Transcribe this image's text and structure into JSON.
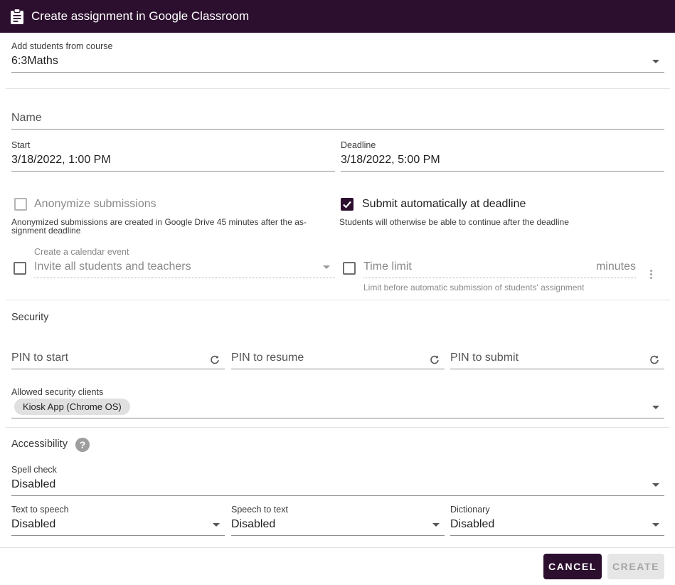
{
  "dialog": {
    "title": "Create assignment in Google Classroom",
    "icon": "clipboard-icon",
    "accent_color": "#2c0f2f"
  },
  "course": {
    "label": "Add students from course",
    "value": "6:3Maths"
  },
  "name": {
    "placeholder": "Name"
  },
  "start": {
    "label": "Start",
    "value": "3/18/2022, 1:00 PM"
  },
  "deadline": {
    "label": "Deadline",
    "value": "3/18/2022, 5:00 PM"
  },
  "anonymize": {
    "label": "Anonymize submissions",
    "help_line1": "Anonymized submissions are created in Google Drive 45 minutes after the as-",
    "help_line2": "signment deadline",
    "checked": false
  },
  "auto_submit": {
    "label": "Submit automatically at deadline",
    "help": "Students will otherwise be able to continue after the deadline",
    "checked": true
  },
  "calendar": {
    "label": "Create a calendar event",
    "value": "Invite all students and teachers",
    "checked": false
  },
  "time_limit": {
    "placeholder": "Time limit",
    "suffix": "minutes",
    "help": "Limit before automatic submission of students' assignment",
    "checked": false
  },
  "security": {
    "heading": "Security",
    "pin_start": "PIN to start",
    "pin_resume": "PIN to resume",
    "pin_submit": "PIN to submit",
    "clients_label": "Allowed security clients",
    "clients": [
      "Kiosk App (Chrome OS)"
    ]
  },
  "accessibility": {
    "heading": "Accessibility",
    "spell_check": {
      "label": "Spell check",
      "value": "Disabled"
    },
    "text_to_speech": {
      "label": "Text to speech",
      "value": "Disabled"
    },
    "speech_to_text": {
      "label": "Speech to text",
      "value": "Disabled"
    },
    "dictionary": {
      "label": "Dictionary",
      "value": "Disabled"
    }
  },
  "actions": {
    "cancel": "CANCEL",
    "create": "CREATE"
  }
}
